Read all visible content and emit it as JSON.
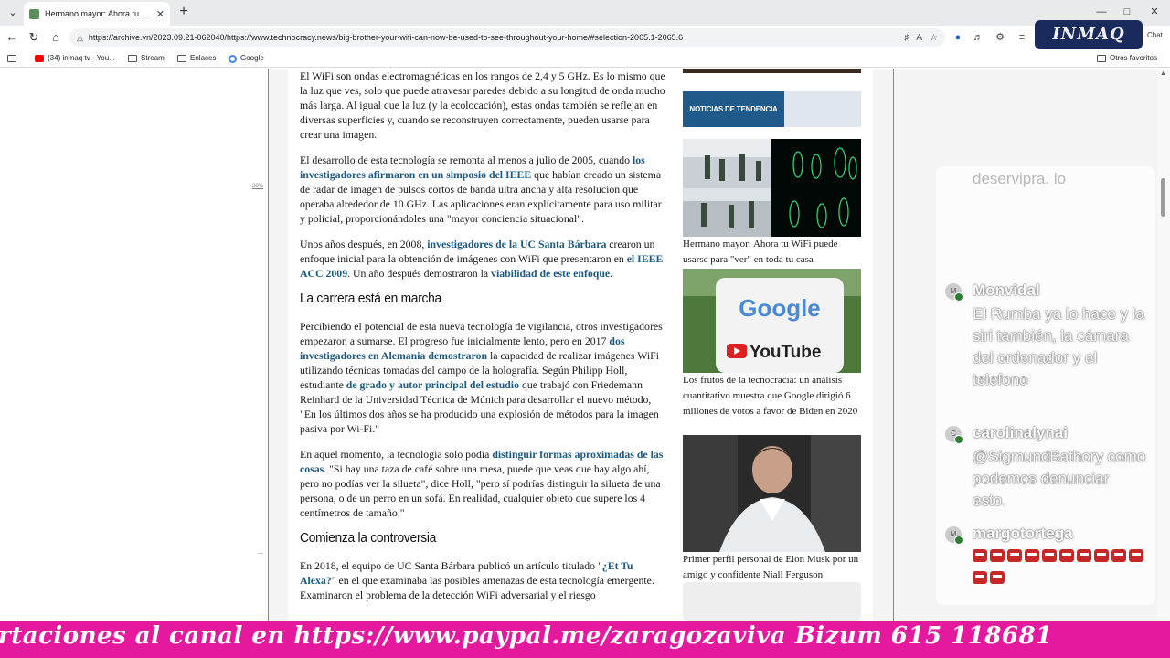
{
  "browser": {
    "tab_title": "Hermano mayor: Ahora tu WiFi puede usarse para",
    "url": "https://archive.vn/2023.09.21-062040/https://www.technocracy.news/big-brother-your-wifi-can-now-be-used-to-see-throughout-your-home/#selection-2065.1-2065.6",
    "chat_label": "Chat",
    "logo_text": "INMAQ",
    "bookmarks": [
      "(34) inmaq tv - You...",
      "Stream",
      "Enlaces",
      "Google"
    ],
    "other_favorites": "Otros favoritos"
  },
  "gutter": {
    "label": "20%"
  },
  "article": {
    "p1": "El WiFi son ondas electromagnéticas en los rangos de 2,4 y 5 GHz. Es lo mismo que la luz que ves, solo que puede atravesar paredes debido a su longitud de onda mucho más larga. Al igual que la luz (y la ecolocación), estas ondas también se reflejan en diversas superficies y, cuando se reconstruyen correctamente, pueden usarse para crear una imagen.",
    "p2_a": "El desarrollo de esta tecnología se remonta al menos a julio de 2005, cuando ",
    "p2_link": "los investigadores afirmaron en un simposio del IEEE",
    "p2_b": " que habían creado un sistema de radar de imagen de pulsos cortos de banda ultra ancha y alta resolución que operaba alrededor de 10 GHz. Las aplicaciones eran explícitamente para uso militar y policial, proporcionándoles una \"mayor conciencia situacional\".",
    "p3_a": "Unos años después, en 2008, ",
    "p3_link1": "investigadores de la UC Santa Bárbara",
    "p3_b": " crearon un enfoque inicial para la obtención de imágenes con WiFi que presentaron en ",
    "p3_link2": "el IEEE ACC 2009",
    "p3_c": ". Un año después demostraron la ",
    "p3_link3": "viabilidad de este enfoque",
    "p3_d": ".",
    "h2_1": "La carrera está en marcha",
    "p4_a": "Percibiendo el potencial de esta nueva tecnología de vigilancia, otros investigadores empezaron a sumarse. El progreso fue inicialmente lento, pero en 2017 ",
    "p4_link1": "dos investigadores en Alemania demostraron",
    "p4_b": " la capacidad de realizar imágenes WiFi utilizando técnicas tomadas del campo de la holografía. Según Philipp Holl, estudiante ",
    "p4_link2": "de grado y autor principal del estudio",
    "p4_c": " que trabajó con Friedemann Reinhard de la Universidad Técnica de Múnich para desarrollar el nuevo método, \"En los últimos dos años se ha producido una explosión de métodos para la imagen pasiva por Wi-Fi.\"",
    "p5_a": "En aquel momento, la tecnología solo podía ",
    "p5_link": "distinguir formas aproximadas de las cosas",
    "p5_b": ". \"Si hay una taza de café sobre una mesa, puede que veas que hay algo ahí, pero no podías ver la silueta\", dice Holl, \"pero sí podrías distinguir la silueta de una persona, o de un perro en un sofá. En realidad, cualquier objeto que supere los 4 centímetros de tamaño.\"",
    "h2_2": "Comienza la controversia",
    "p6_a": "En 2018, el equipo de UC Santa Bárbara publicó un artículo titulado \"",
    "p6_link": "¿Et Tu Alexa?",
    "p6_b": "\" en el que examinaba las posibles amenazas de esta tecnología emergente. Examinaron el problema de la detección WiFi adversarial y el riesgo"
  },
  "sidebar": {
    "trending_label": "NOTICIAS DE TENDENCIA",
    "items": [
      {
        "caption": "Hermano mayor: Ahora tu WiFi puede usarse para \"ver\" en toda tu casa"
      },
      {
        "caption": "Los frutos de la tecnocracia: un análisis cuantitativo muestra que Google dirigió 6 millones de votos a favor de Biden en 2020"
      },
      {
        "caption": "Primer perfil personal de Elon Musk por un amigo y confidente Niall Ferguson"
      }
    ],
    "google_text": "Google",
    "youtube_text": "YouTube"
  },
  "chat": {
    "faded_text": "deservipra. lo",
    "messages": [
      {
        "initial": "M",
        "user": "Monvidal",
        "text": "El Rumba ya lo hace y la siri también, la cámara del ordenador y el telefono"
      },
      {
        "initial": "C",
        "user": "carolinalynai",
        "text": "@SigmundBathory como podemos denunciar esto."
      },
      {
        "initial": "M",
        "user": "margotortega",
        "text": ""
      }
    ]
  },
  "ticker": {
    "text": "rtaciones al canal en https://www.paypal.me/zaragozaviva Bizum 615 118681"
  },
  "colors": {
    "link": "#1b5a86",
    "trend_label_bg": "#1f5a8a",
    "ticker_bg": "#e4199e"
  }
}
